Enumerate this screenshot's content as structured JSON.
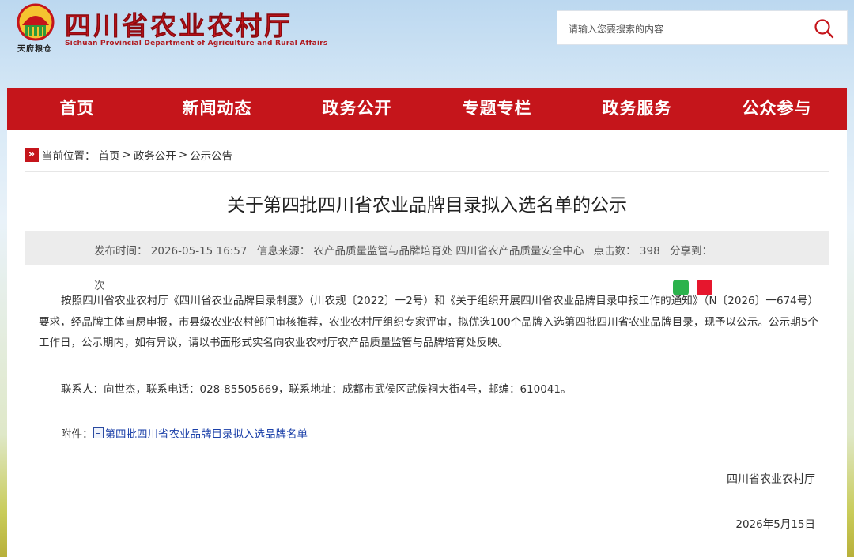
{
  "header": {
    "seal_text": "天府粮仓",
    "brand_cn": "四川省农业农村厅",
    "brand_en": "Sichuan Provincial Department of Agriculture and Rural Affairs",
    "search_placeholder": "请输入您要搜索的内容"
  },
  "nav": [
    "首页",
    "新闻动态",
    "政务公开",
    "专题专栏",
    "政务服务",
    "公众参与"
  ],
  "breadcrumb": {
    "label": "当前位置：",
    "items": [
      "首页",
      "政务公开",
      "公示公告"
    ],
    "separator": ">"
  },
  "article": {
    "title": "关于第四批四川省农业品牌目录拟入选名单的公示",
    "meta": {
      "publish_time": "发布时间：  2026-05-15 16:57",
      "source": "信息来源：  农产品质量监管与品牌培育处 四川省农产品质量安全中心",
      "clicks": "点击数：  398",
      "share": "分享到：",
      "ci": "次"
    },
    "body": "按照四川省农业农村厅《四川省农业品牌目录制度》（川农规〔2022〕一2号）和《关于组织开展四川省农业品牌目录申报工作的通知》（N〔2026〕一674号）要求，经品牌主体自愿申报，市县级农业农村部门审核推荐，农业农村厅组织专家评审，拟优选100个品牌入选第四批四川省农业品牌目录，现予以公示。公示期5个工作日，公示期内，如有异议，请以书面形式实名向农业农村厅农产品质量监管与品牌培育处反映。",
    "contact": "联系人：向世杰，联系电话：028-85505669，联系地址：成都市武侯区武侯祠大街4号，邮编：610041。",
    "attachment_label": "附件：",
    "attachment_link": "第四批四川省农业品牌目录拟入选品牌名单",
    "sign_org": "四川省农业农村厅",
    "sign_date": "2026年5月15日"
  },
  "colors": {
    "brand_red": "#c5151b",
    "link_blue": "#1a3fa8"
  }
}
